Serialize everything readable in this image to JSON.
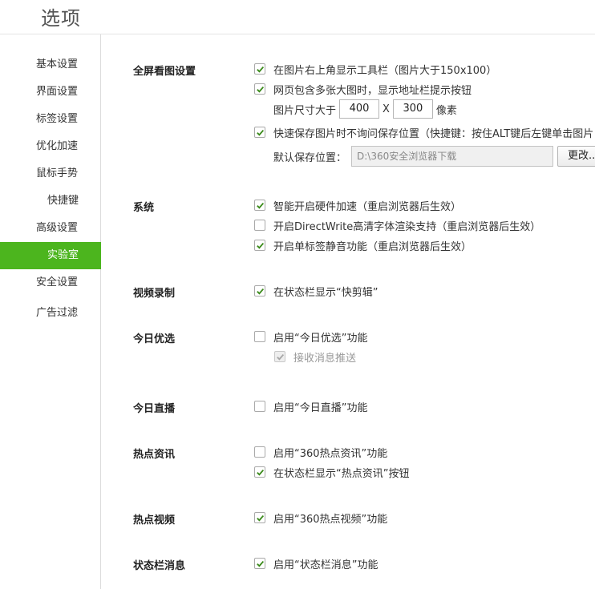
{
  "window": {
    "title": "选项"
  },
  "sidebar": {
    "items": [
      {
        "label": "基本设置",
        "active": false
      },
      {
        "label": "界面设置",
        "active": false
      },
      {
        "label": "标签设置",
        "active": false
      },
      {
        "label": "优化加速",
        "active": false
      },
      {
        "label": "鼠标手势",
        "active": false
      },
      {
        "label": "快捷键",
        "active": false
      },
      {
        "label": "高级设置",
        "active": false
      },
      {
        "label": "实验室",
        "active": true
      },
      {
        "label": "安全设置",
        "active": false
      },
      {
        "label": "广告过滤",
        "active": false
      }
    ]
  },
  "accent_color": "#4cb51e",
  "sections": {
    "fullscreen": {
      "title": "全屏看图设置",
      "opt1": {
        "label": "在图片右上角显示工具栏（图片大于150x100）",
        "checked": true
      },
      "opt2": {
        "label": "网页包含多张大图时，显示地址栏提示按钮",
        "checked": true
      },
      "size": {
        "prefix": "图片尺寸大于",
        "width": "400",
        "separator": "X",
        "height": "300",
        "suffix": "像素"
      },
      "opt3": {
        "label": "快速保存图片时不询问保存位置（快捷键：按住ALT键后左键单击图片",
        "checked": true
      },
      "save_path": {
        "label": "默认保存位置：",
        "value": "D:\\360安全浏览器下载",
        "button": "更改..."
      }
    },
    "system": {
      "title": "系统",
      "opt1": {
        "label": "智能开启硬件加速（重启浏览器后生效）",
        "checked": true
      },
      "opt2": {
        "label": "开启DirectWrite高清字体渲染支持（重启浏览器后生效）",
        "checked": false
      },
      "opt3": {
        "label": "开启单标签静音功能（重启浏览器后生效）",
        "checked": true
      }
    },
    "video": {
      "title": "视频录制",
      "opt1": {
        "label": "在状态栏显示“快剪辑”",
        "checked": true
      }
    },
    "today_pick": {
      "title": "今日优选",
      "opt1": {
        "label": "启用“今日优选”功能",
        "checked": false
      },
      "opt2": {
        "label": "接收消息推送",
        "checked": true,
        "disabled": true
      }
    },
    "live": {
      "title": "今日直播",
      "opt1": {
        "label": "启用“今日直播”功能",
        "checked": false
      }
    },
    "hot_news": {
      "title": "热点资讯",
      "opt1": {
        "label": "启用“360热点资讯”功能",
        "checked": false
      },
      "opt2": {
        "label": "在状态栏显示“热点资讯”按钮",
        "checked": true
      }
    },
    "hot_video": {
      "title": "热点视频",
      "opt1": {
        "label": "启用“360热点视频”功能",
        "checked": true
      }
    },
    "status_msg": {
      "title": "状态栏消息",
      "opt1": {
        "label": "启用“状态栏消息”功能",
        "checked": true
      }
    }
  }
}
